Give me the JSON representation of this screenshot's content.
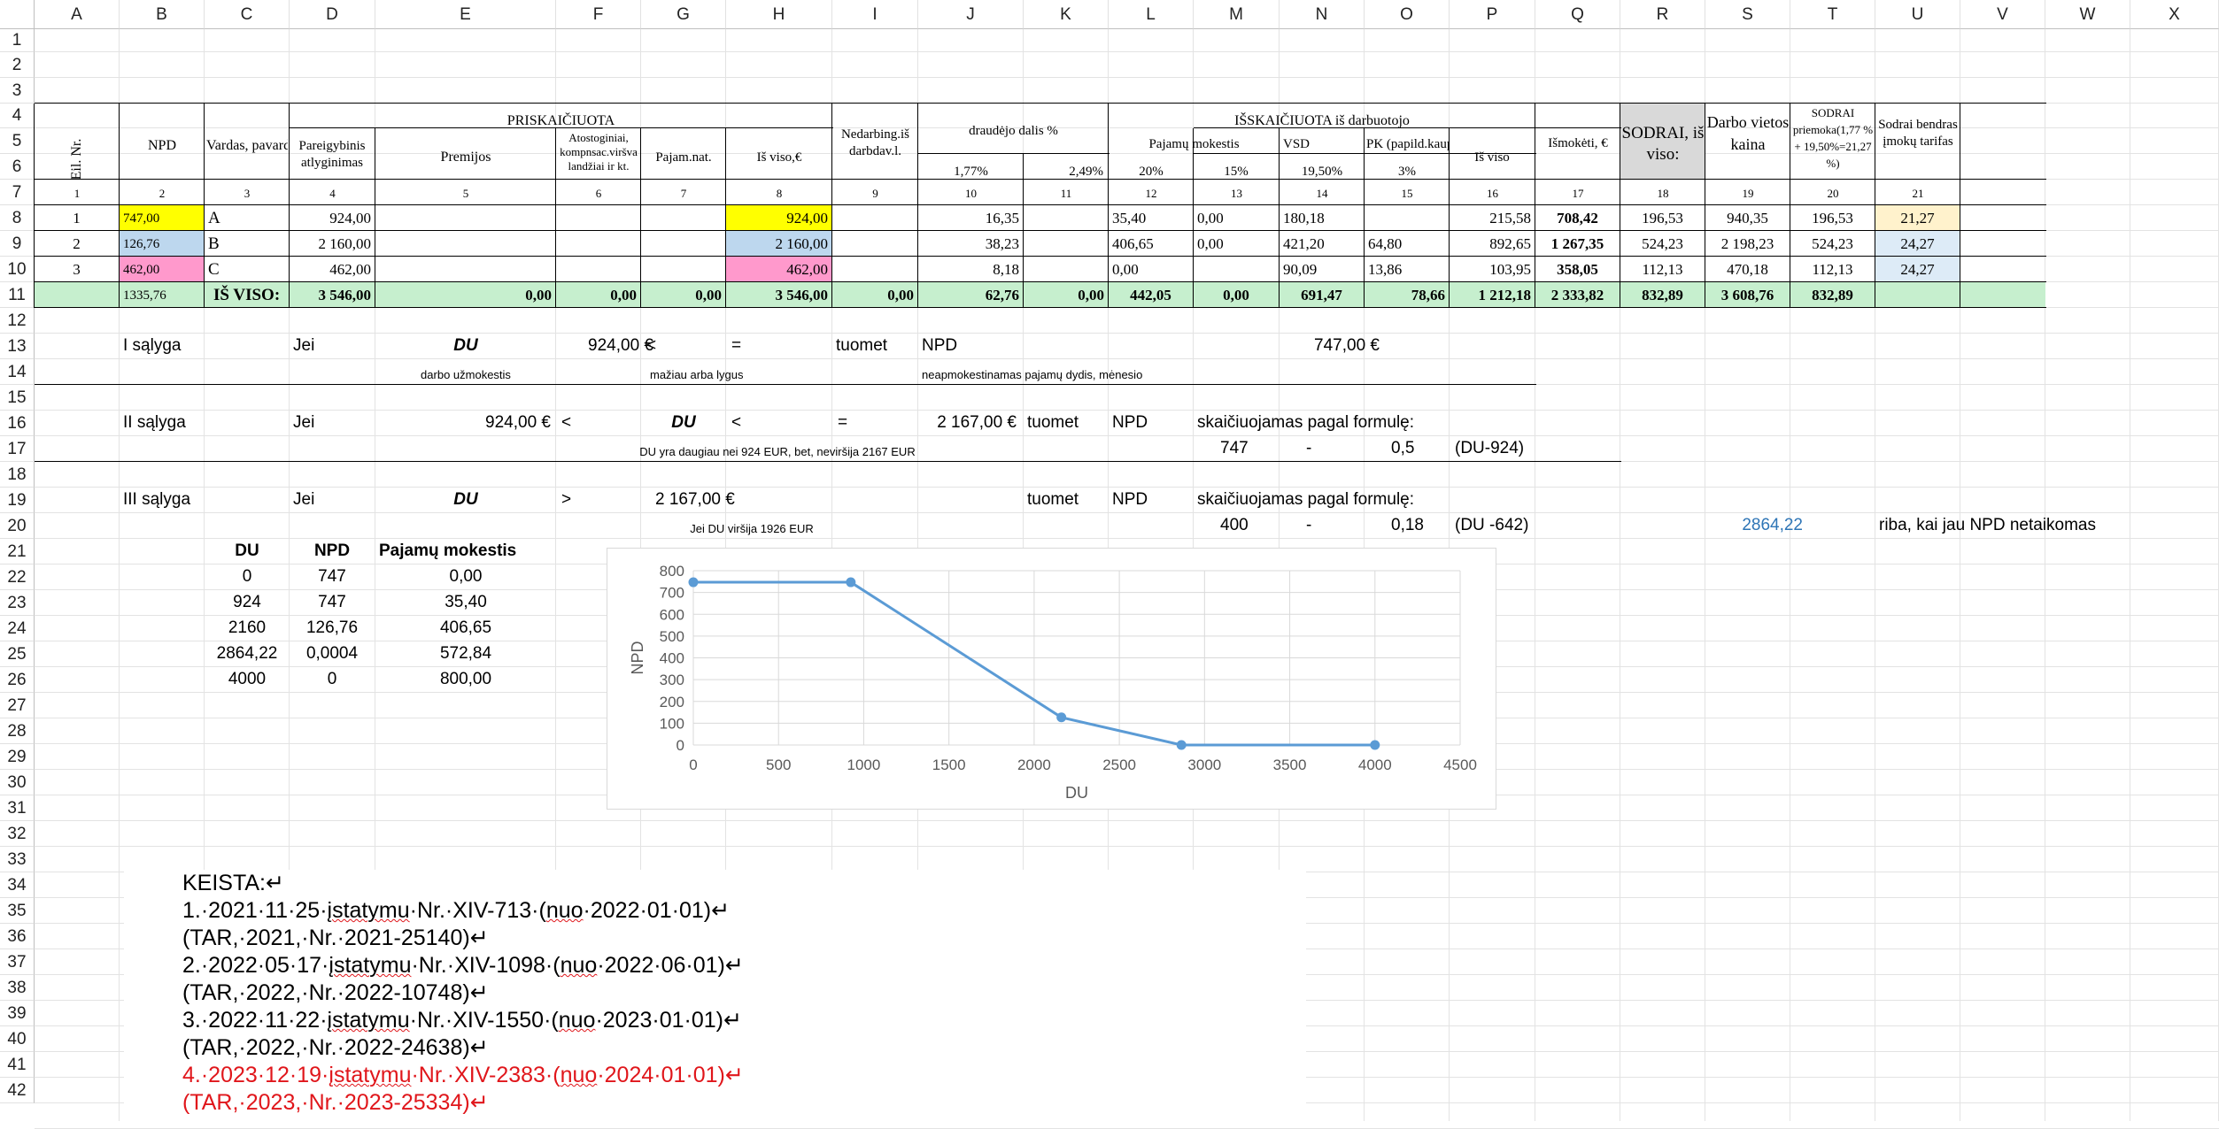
{
  "columns": [
    "A",
    "B",
    "C",
    "D",
    "E",
    "F",
    "G",
    "H",
    "I",
    "J",
    "K",
    "L",
    "M",
    "N",
    "O",
    "P",
    "Q",
    "R",
    "S",
    "T",
    "U",
    "V",
    "W",
    "X"
  ],
  "rows": [
    "1",
    "2",
    "3",
    "4",
    "5",
    "6",
    "7",
    "8",
    "9",
    "10",
    "11",
    "12",
    "13",
    "14",
    "15",
    "16",
    "17",
    "18",
    "19",
    "20",
    "21",
    "22",
    "23",
    "24",
    "25",
    "26",
    "27",
    "28",
    "29",
    "30",
    "31",
    "32",
    "33",
    "34",
    "35",
    "36",
    "37",
    "38",
    "39",
    "40",
    "41",
    "42"
  ],
  "header": {
    "eil_nr": "Eil. Nr.",
    "npd": "NPD",
    "vardas": "Vardas, pavardė",
    "priskaiciuota": "PRISKAIČIUOTA",
    "pareigybinis": "Pareigybinis atlyginimas",
    "premijos": "Premijos",
    "atostoginiai": "Atostoginiai, kompnsac.viršva landžiai ir kt.",
    "pajam_nat": "Pajam.nat.",
    "is_viso_eur": "Iš viso,€",
    "nedarbing": "Nedarbing.iš darbdav.l.",
    "draudejo": "draudėjo dalis %",
    "draud_pct1": "1,77%",
    "draud_pct2": "2,49%",
    "isskaiciuota": "IŠSKAIČIUOTA iš darbuotojo",
    "pajamu_mok": "Pajamų mokestis",
    "pm_20": "20%",
    "pm_15": "15%",
    "vsd": "VSD",
    "vsd_pct": "19,50%",
    "pk": "PK (papild.kaup)",
    "pk_pct": "3%",
    "is_viso": "Iš viso",
    "ismoketi": "Išmokėti, €",
    "sodrai": "SODRAI, iš viso:",
    "darbo_vietos": "Darbo vietos kaina",
    "sodrai_priemoka": "SODRAI priemoka(1,77 % + 19,50%=21,27 %)",
    "sodrai_tarifas": "Sodrai bendras įmokų tarifas",
    "col_numbers": [
      "1",
      "2",
      "3",
      "4",
      "5",
      "6",
      "7",
      "8",
      "9",
      "10",
      "11",
      "12",
      "13",
      "14",
      "15",
      "16",
      "17",
      "18",
      "19",
      "20",
      "21"
    ]
  },
  "employees": [
    {
      "nr": "1",
      "npd": "747,00",
      "name": "A",
      "pareig": "924,00",
      "isviso": "924,00",
      "draud": "16,35",
      "pm20": "35,40",
      "pm15": "0,00",
      "vsd": "180,18",
      "pk": "",
      "isviso2": "215,58",
      "ismoketi": "708,42",
      "sodrai": "196,53",
      "darbo": "940,35",
      "priemoka": "196,53",
      "tarifas": "21,27"
    },
    {
      "nr": "2",
      "npd": "126,76",
      "name": "B",
      "pareig": "2 160,00",
      "isviso": "2 160,00",
      "draud": "38,23",
      "pm20": "406,65",
      "pm15": "0,00",
      "vsd": "421,20",
      "pk": "64,80",
      "isviso2": "892,65",
      "ismoketi": "1 267,35",
      "sodrai": "524,23",
      "darbo": "2 198,23",
      "priemoka": "524,23",
      "tarifas": "24,27"
    },
    {
      "nr": "3",
      "npd": "462,00",
      "name": "C",
      "pareig": "462,00",
      "isviso": "462,00",
      "draud": "8,18",
      "pm20": "0,00",
      "pm15": "",
      "vsd": "90,09",
      "pk": "13,86",
      "isviso2": "103,95",
      "ismoketi": "358,05",
      "sodrai": "112,13",
      "darbo": "470,18",
      "priemoka": "112,13",
      "tarifas": "24,27"
    }
  ],
  "totals": {
    "npd": "1335,76",
    "label": "IŠ VISO:",
    "pareig": "3 546,00",
    "premijos": "0,00",
    "atost": "0,00",
    "pajam": "0,00",
    "isviso": "3 546,00",
    "nedarb": "0,00",
    "draud1": "62,76",
    "draud2": "0,00",
    "pm20": "442,05",
    "pm15": "0,00",
    "vsd": "691,47",
    "pk": "78,66",
    "isviso2": "1 212,18",
    "ismoketi": "2 333,82",
    "sodrai": "832,89",
    "darbo": "3 608,76",
    "priemoka": "832,89"
  },
  "cond1": {
    "label": "I sąlyga",
    "jei": "Jei",
    "du": "DU",
    "val": "924,00 €",
    "lt": "<",
    "eq": "=",
    "tuomet": "tuomet",
    "npd": "NPD",
    "npdval": "747,00 €",
    "note_du": "darbo užmokestis",
    "note_maz": "mažiau arba lygus",
    "note_neap": "neapmokestinamas pajamų dydis, mėnesio"
  },
  "cond2": {
    "label": "II sąlyga",
    "jei": "Jei",
    "val1": "924,00 €",
    "lt1": "<",
    "du": "DU",
    "lt2": "<",
    "eq": "=",
    "val2": "2 167,00 €",
    "tuomet": "tuomet",
    "npd": "NPD",
    "formula": "skaičiuojamas pagal formulę:",
    "note": "DU yra daugiau nei 924 EUR, bet, neviršija 2167 EUR",
    "f1": "747",
    "f2": "-",
    "f3": "0,5",
    "f4": "(DU-924)"
  },
  "cond3": {
    "label": "III sąlyga",
    "jei": "Jei",
    "du": "DU",
    "gt": ">",
    "val": "2 167,00 €",
    "tuomet": "tuomet",
    "npd": "NPD",
    "formula": "skaičiuojamas pagal formulę:",
    "note": "Jei DU viršija 1926 EUR",
    "f1": "400",
    "f2": "-",
    "f3": "0,18",
    "f4": "(DU -642)",
    "riba_val": "2864,22",
    "riba_text": "riba, kai jau NPD netaikomas"
  },
  "small_table": {
    "headers": [
      "DU",
      "NPD",
      "Pajamų mokestis"
    ],
    "rows": [
      [
        "0",
        "747",
        "0,00"
      ],
      [
        "924",
        "747",
        "35,40"
      ],
      [
        "2160",
        "126,76",
        "406,65"
      ],
      [
        "2864,22",
        "0,0004",
        "572,84"
      ],
      [
        "4000",
        "0",
        "800,00"
      ]
    ]
  },
  "chart_data": {
    "type": "line",
    "xlabel": "DU",
    "ylabel": "NPD",
    "x": [
      0,
      924,
      2160,
      2864.22,
      4000
    ],
    "series": [
      {
        "values": [
          747,
          747,
          126.76,
          0.0004,
          0
        ]
      }
    ],
    "xlim": [
      0,
      4500
    ],
    "ylim": [
      0,
      800
    ],
    "xticks": [
      0,
      500,
      1000,
      1500,
      2000,
      2500,
      3000,
      3500,
      4000,
      4500
    ],
    "yticks": [
      0,
      100,
      200,
      300,
      400,
      500,
      600,
      700,
      800
    ],
    "grid": true,
    "color": "#5b9bd5"
  },
  "notes": {
    "title": "KEISTA:",
    "items": [
      {
        "a": "1.·2021·11·25·",
        "w1": "įstatymu",
        "b": "·Nr.·XIV-713·(",
        "w2": "nuo",
        "c": "·2022·01·01)",
        "red": false
      },
      {
        "a": "(TAR,·2021,·Nr.·2021-25140)",
        "w1": "",
        "b": "",
        "w2": "",
        "c": "",
        "red": false
      },
      {
        "a": "2.·2022·05·17·",
        "w1": "įstatymu",
        "b": "·Nr.·XIV-1098·(",
        "w2": "nuo",
        "c": "·2022·06·01)",
        "red": false
      },
      {
        "a": "(TAR,·2022,·Nr.·2022-10748)",
        "w1": "",
        "b": "",
        "w2": "",
        "c": "",
        "red": false
      },
      {
        "a": "3.·2022·11·22·",
        "w1": "įstatymu",
        "b": "·Nr.·XIV-1550·(",
        "w2": "nuo",
        "c": "·2023·01·01)",
        "red": false
      },
      {
        "a": "(TAR,·2022,·Nr.·2022-24638)",
        "w1": "",
        "b": "",
        "w2": "",
        "c": "",
        "red": false
      },
      {
        "a": "4.·2023·12·19·",
        "w1": "įstatymu",
        "b": "·Nr.·XIV-2383·(",
        "w2": "nuo",
        "c": "·2024·01·01)",
        "red": true
      },
      {
        "a": "(TAR,·2023,·Nr.·2023-25334)",
        "w1": "",
        "b": "",
        "w2": "",
        "c": "",
        "red": true
      }
    ],
    "mark": "↵"
  },
  "colors": {
    "yellow": "#ffff00",
    "blue": "#bdd7ee",
    "pink": "#ff99cc",
    "green": "#c6efce",
    "ltyellow": "#fff2cc",
    "ltblue": "#ddebf7",
    "gray": "#d9d9d9",
    "link": "#2e75b6"
  }
}
